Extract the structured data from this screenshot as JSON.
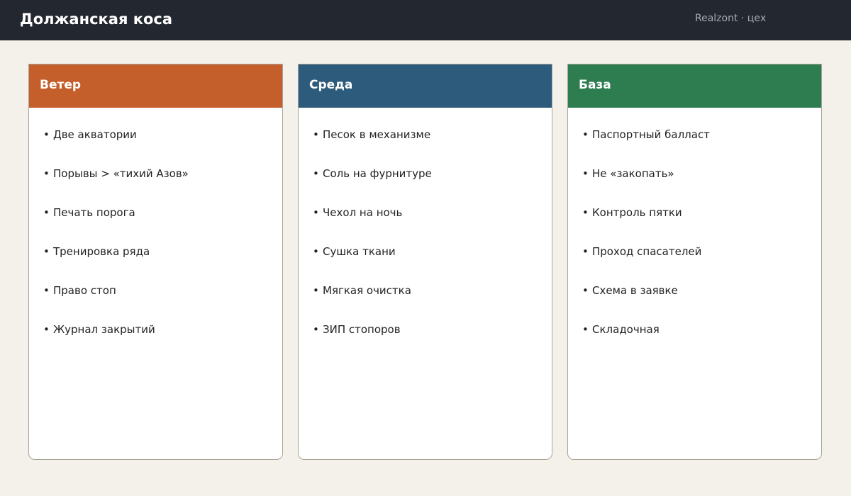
{
  "header": {
    "title": "Должанская коса",
    "meta": "Realzont · цех"
  },
  "columns": [
    {
      "title": "Ветер",
      "color": "#c45e2b",
      "items": [
        "Две акватории",
        "Порывы > «тихий Азов»",
        "Печать порога",
        "Тренировка ряда",
        "Право стоп",
        "Журнал закрытий"
      ]
    },
    {
      "title": "Среда",
      "color": "#2d5b7b",
      "items": [
        "Песок в механизме",
        "Соль на фурнитуре",
        "Чехол на ночь",
        "Сушка ткани",
        "Мягкая очистка",
        "ЗИП стопоров"
      ]
    },
    {
      "title": "База",
      "color": "#2e7d51",
      "items": [
        "Паспортный балласт",
        "Не «закопать»",
        "Контроль пятки",
        "Проход спасателей",
        "Схема в заявке",
        "Складочная"
      ]
    }
  ]
}
